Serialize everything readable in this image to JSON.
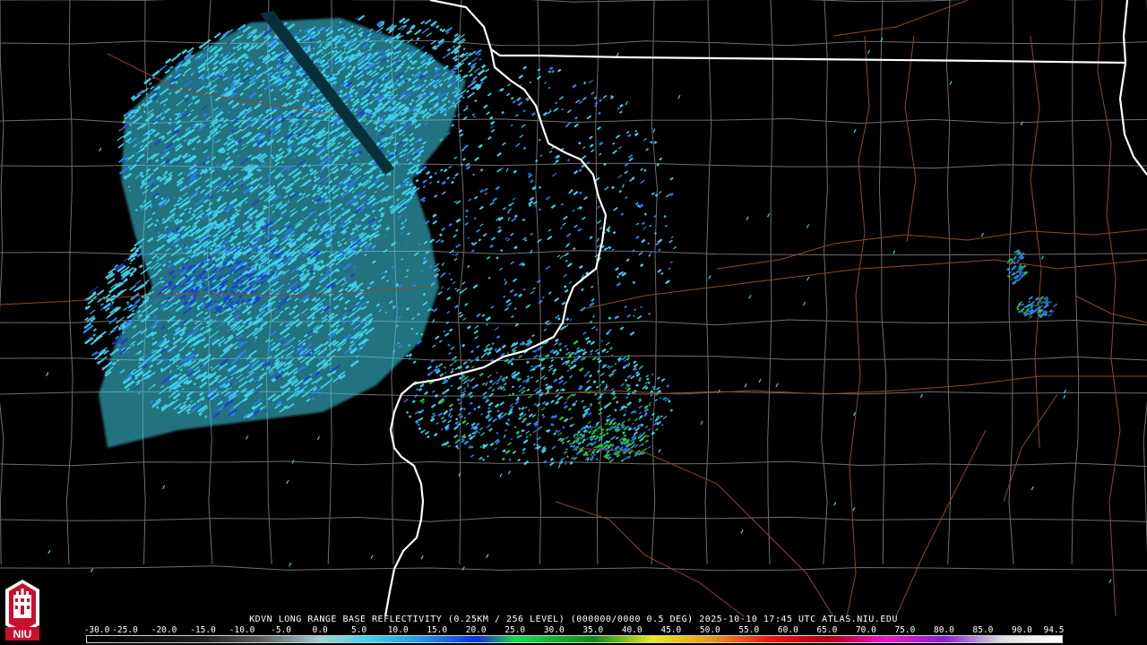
{
  "caption": "KDVN LONG RANGE BASE REFLECTIVITY (0.25KM / 256 LEVEL) (000000/0000 0.5 DEG) 2025-10-10 17:45 UTC  ATLAS.NIU.EDU",
  "scale_ticks": [
    "-30.0",
    "-25.0",
    "-20.0",
    "-15.0",
    "-10.0",
    "-5.0",
    "0.0",
    "5.0",
    "10.0",
    "15.0",
    "20.0",
    "25.0",
    "30.0",
    "35.0",
    "40.0",
    "45.0",
    "50.0",
    "55.0",
    "60.0",
    "65.0",
    "70.0",
    "75.0",
    "80.0",
    "85.0",
    "90.0",
    "94.5"
  ],
  "logo_text": "NIU",
  "colors": {
    "background": "#000000",
    "county_lines": "#6e6e6e",
    "state_lines": "#ffffff",
    "highways": "#8a4a2c",
    "echo_light": "#3fd0e8",
    "echo_mid": "#2a7ee8",
    "echo_dark": "#1a3fd8",
    "echo_green": "#22c230",
    "logo_red": "#c8102e"
  }
}
